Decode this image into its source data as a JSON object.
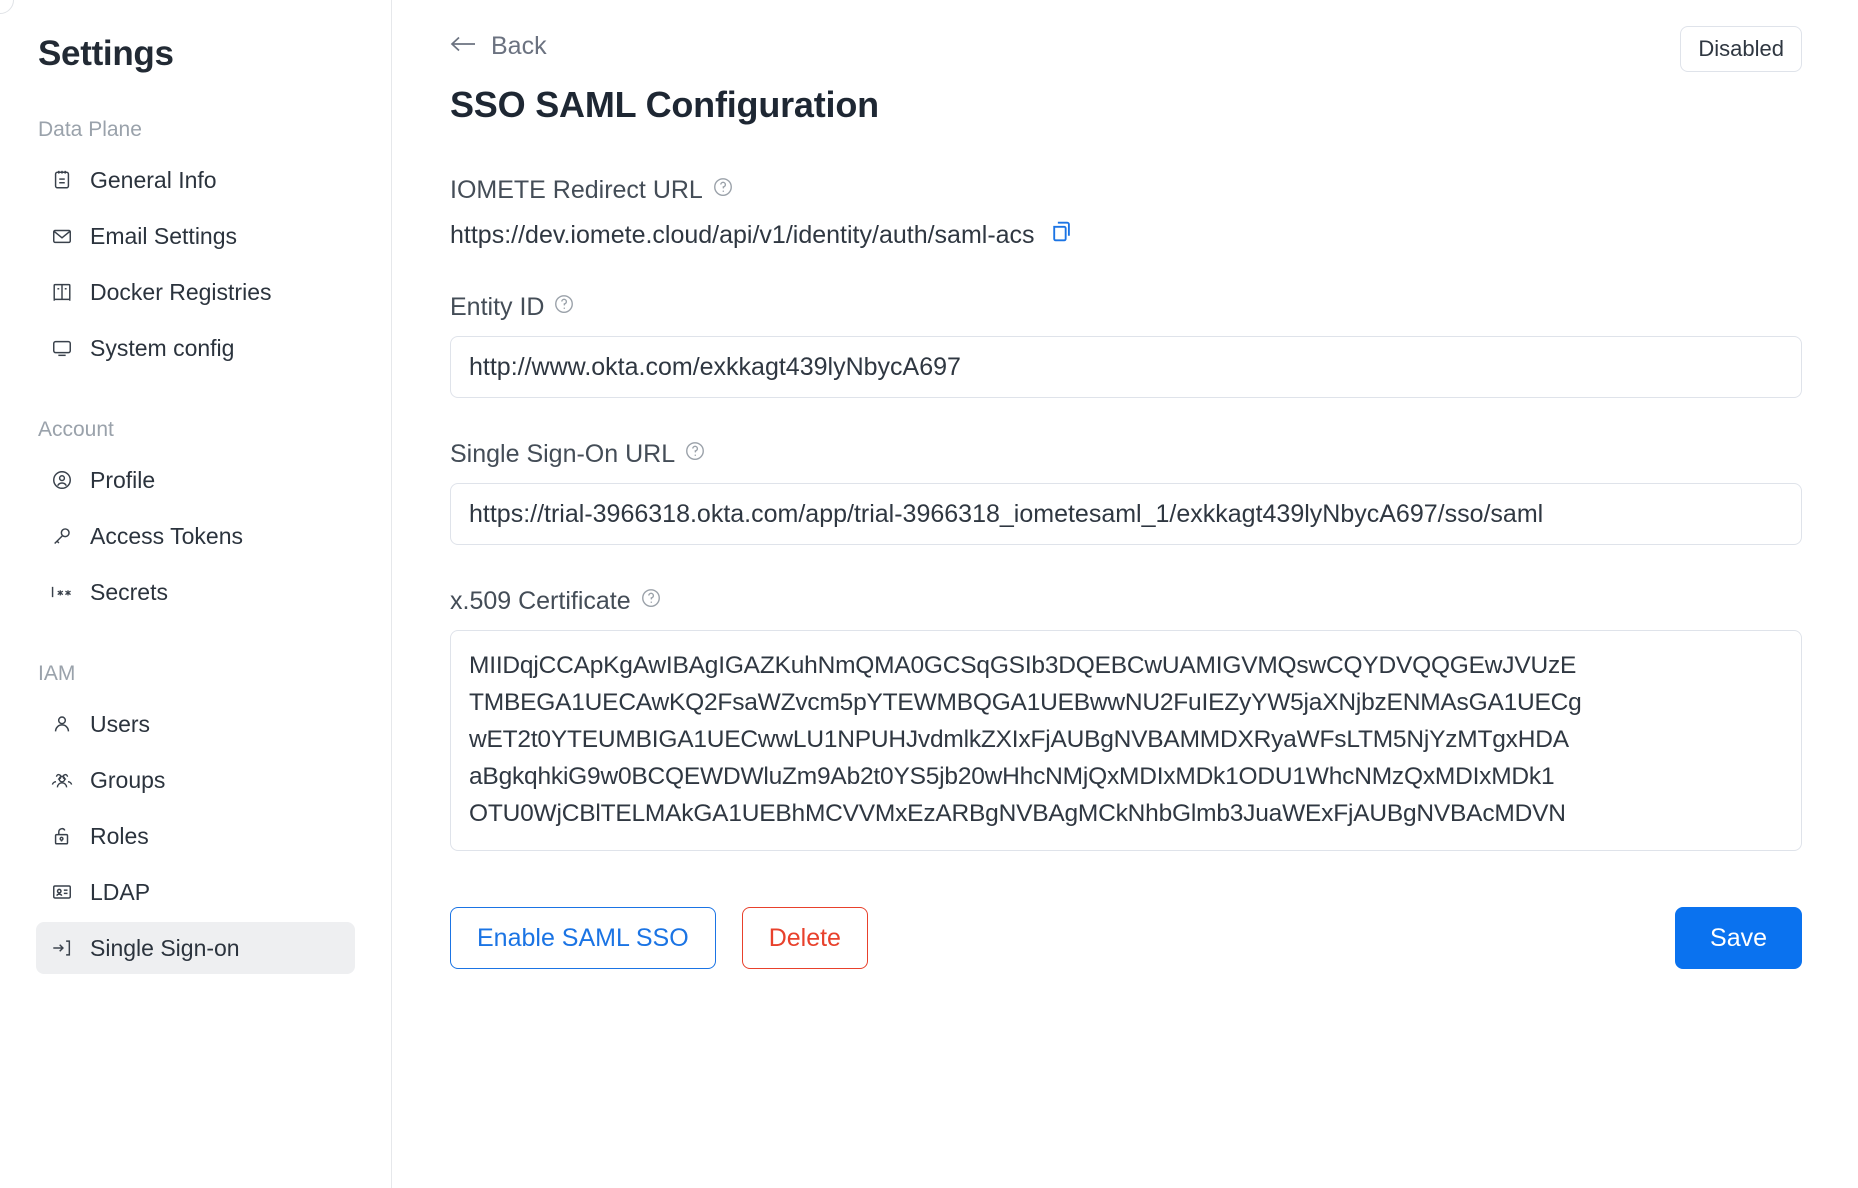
{
  "sidebar": {
    "title": "Settings",
    "groups": [
      {
        "label": "Data Plane",
        "items": [
          {
            "label": "General Info",
            "icon": "notepad-icon"
          },
          {
            "label": "Email Settings",
            "icon": "envelope-icon"
          },
          {
            "label": "Docker Registries",
            "icon": "registry-icon"
          },
          {
            "label": "System config",
            "icon": "monitor-icon"
          }
        ]
      },
      {
        "label": "Account",
        "items": [
          {
            "label": "Profile",
            "icon": "user-circle-icon"
          },
          {
            "label": "Access Tokens",
            "icon": "key-icon"
          },
          {
            "label": "Secrets",
            "icon": "asterisk-icon"
          }
        ]
      },
      {
        "label": "IAM",
        "items": [
          {
            "label": "Users",
            "icon": "user-icon"
          },
          {
            "label": "Groups",
            "icon": "users-group-icon"
          },
          {
            "label": "Roles",
            "icon": "unlocked-padlock-icon"
          },
          {
            "label": "LDAP",
            "icon": "id-card-icon"
          },
          {
            "label": "Single Sign-on",
            "icon": "login-arrow-icon",
            "selected": true
          }
        ]
      }
    ]
  },
  "header": {
    "back_label": "Back",
    "page_title": "SSO SAML Configuration",
    "status_badge": "Disabled"
  },
  "form": {
    "redirect_url": {
      "label": "IOMETE Redirect URL",
      "value": "https://dev.iomete.cloud/api/v1/identity/auth/saml-acs",
      "copy_icon": "copy-icon"
    },
    "entity_id": {
      "label": "Entity ID",
      "value": "http://www.okta.com/exkkagt439lyNbycA697"
    },
    "sso_url": {
      "label": "Single Sign-On URL",
      "value": "https://trial-3966318.okta.com/app/trial-3966318_iometesaml_1/exkkagt439lyNbycA697/sso/saml"
    },
    "certificate": {
      "label": "x.509 Certificate",
      "lines": [
        "MIIDqjCCApKgAwIBAgIGAZKuhNmQMA0GCSqGSIb3DQEBCwUAMIGVMQswCQYDVQQGEwJVUzE",
        "TMBEGA1UECAwKQ2FsaWZvcm5pYTEWMBQGA1UEBwwNU2FuIEZyYW5jaXNjbzENMAsGA1UECg",
        "wET2t0YTEUMBIGA1UECwwLU1NPUHJvdmlkZXIxFjAUBgNVBAMMDXRyaWFsLTM5NjYzMTgxHDA",
        "aBgkqhkiG9w0BCQEWDWluZm9Ab2t0YS5jb20wHhcNMjQxMDIxMDk1ODU1WhcNMzQxMDIxMDk1",
        "OTU0WjCBlTELMAkGA1UEBhMCVVMxEzARBgNVBAgMCkNhbGlmb3JuaWExFjAUBgNVBAcMDVN"
      ]
    }
  },
  "buttons": {
    "enable_saml_sso": "Enable SAML SSO",
    "delete": "Delete",
    "save": "Save"
  },
  "colors": {
    "accent_blue": "#1b74e4",
    "primary_blue": "#0a72ef",
    "danger_red": "#e8412c",
    "border": "#dfe3ea"
  }
}
